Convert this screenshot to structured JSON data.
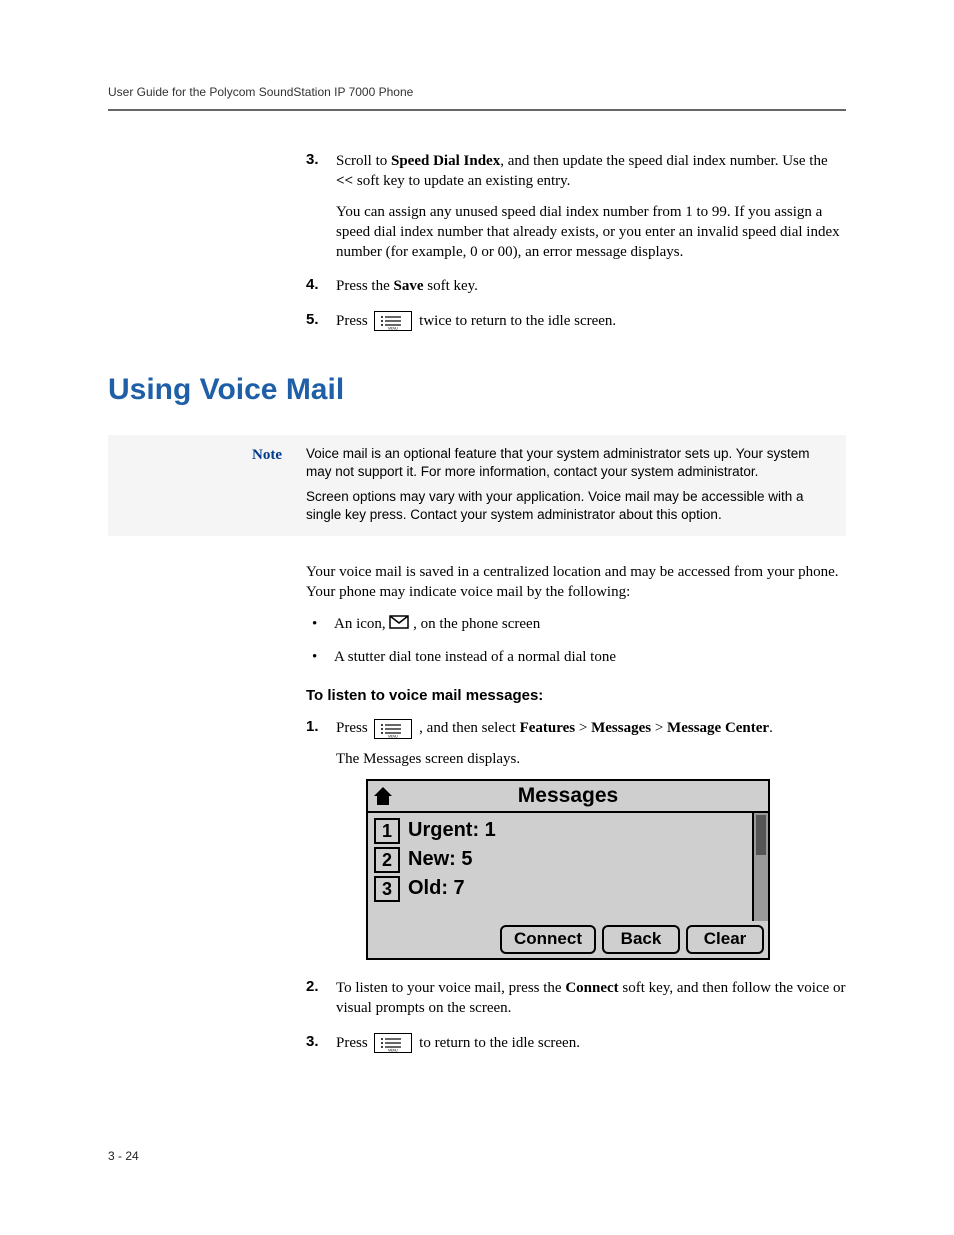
{
  "header": "User Guide for the Polycom SoundStation IP 7000 Phone",
  "prev_steps": {
    "s3_a": "Scroll to ",
    "s3_bold": "Speed Dial Index",
    "s3_b": ", and then update the speed dial index number. Use the ",
    "s3_key": "<<",
    "s3_c": " soft key to update an existing entry.",
    "s3_p2": "You can assign any unused speed dial index number from 1 to 99. If you assign a speed dial index number that already exists, or you enter an invalid speed dial index number (for example, 0 or 00), an error message displays.",
    "s4_a": "Press the ",
    "s4_bold": "Save",
    "s4_b": " soft key.",
    "s5_a": "Press ",
    "s5_b": " twice to return to the idle screen."
  },
  "section_title": "Using Voice Mail",
  "note": {
    "label": "Note",
    "p1": "Voice mail is an optional feature that your system administrator sets up. Your system may not support it. For more information, contact your system administrator.",
    "p2": "Screen options may vary with your application. Voice mail may be accessible with a single key press. Contact your system administrator about this option."
  },
  "body_para": "Your voice mail is saved in a centralized location and may be accessed from your phone. Your phone may indicate voice mail by the following:",
  "bullets": {
    "b1_a": "An icon, ",
    "b1_b": ", on the phone screen",
    "b2": "A stutter dial tone instead of a normal dial tone"
  },
  "subhead": "To listen to voice mail messages:",
  "steps": {
    "s1_a": "Press ",
    "s1_b": ", and then select ",
    "s1_path1": "Features",
    "s1_sep": " > ",
    "s1_path2": "Messages",
    "s1_path3": "Message Center",
    "s1_end": ".",
    "s1_p2": "The Messages screen displays.",
    "s2_a": "To listen to your voice mail, press the ",
    "s2_bold": "Connect",
    "s2_b": " soft key, and then follow the voice or visual prompts on the screen.",
    "s3_a": "Press ",
    "s3_b": " to return to the idle screen."
  },
  "phone": {
    "title": "Messages",
    "rows": [
      {
        "idx": "1",
        "label": "Urgent: 1"
      },
      {
        "idx": "2",
        "label": "New: 5"
      },
      {
        "idx": "3",
        "label": "Old: 7"
      }
    ],
    "softkeys": {
      "k1": "Connect",
      "k2": "Back",
      "k3": "Clear"
    }
  },
  "footer": "3 - 24"
}
